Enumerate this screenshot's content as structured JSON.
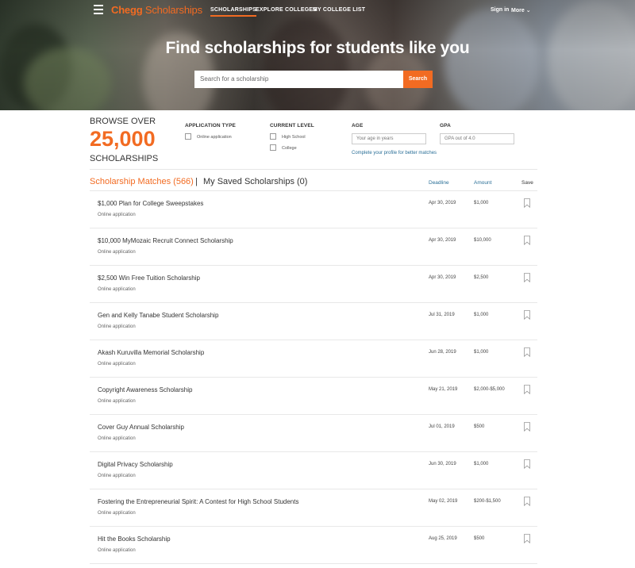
{
  "header": {
    "brand_bold": "Chegg",
    "brand_light": " Scholarships",
    "nav": [
      "SCHOLARSHIPS",
      "EXPLORE COLLEGES",
      "MY COLLEGE LIST"
    ],
    "signin": "Sign in",
    "more": "More",
    "accent": "#f26b22"
  },
  "hero": {
    "title": "Find scholarships for students like you",
    "search_placeholder": "Search for a scholarship",
    "search_button": "Search"
  },
  "browse": {
    "over": "BROWSE OVER",
    "count": "25,000",
    "label": "SCHOLARSHIPS"
  },
  "filters": {
    "application_type": {
      "label": "APPLICATION TYPE",
      "options": [
        "Online application"
      ]
    },
    "current_level": {
      "label": "CURRENT LEVEL",
      "options": [
        "High School",
        "College"
      ]
    },
    "age": {
      "label": "AGE",
      "placeholder": "Your age in years"
    },
    "gpa": {
      "label": "GPA",
      "placeholder": "GPA out of 4.0"
    },
    "profile_link": "Complete your profile for better matches"
  },
  "list": {
    "matches_label": "Scholarship Matches (566)",
    "separator": "|",
    "saved_label": "My Saved Scholarships (0)",
    "col_deadline": "Deadline",
    "col_amount": "Amount",
    "col_save": "Save",
    "rows": [
      {
        "name": "$1,000 Plan for College Sweepstakes",
        "type": "Online application",
        "deadline": "Apr 30, 2019",
        "amount": "$1,000"
      },
      {
        "name": "$10,000 MyMozaic Recruit Connect Scholarship",
        "type": "Online application",
        "deadline": "Apr 30, 2019",
        "amount": "$10,000"
      },
      {
        "name": "$2,500 Win Free Tuition Scholarship",
        "type": "Online application",
        "deadline": "Apr 30, 2019",
        "amount": "$2,500"
      },
      {
        "name": "Gen and Kelly Tanabe Student Scholarship",
        "type": "Online application",
        "deadline": "Jul 31, 2019",
        "amount": "$1,000"
      },
      {
        "name": "Akash Kuruvilla Memorial Scholarship",
        "type": "Online application",
        "deadline": "Jun 28, 2019",
        "amount": "$1,000"
      },
      {
        "name": "Copyright Awareness Scholarship",
        "type": "Online application",
        "deadline": "May 21, 2019",
        "amount": "$2,000-$5,000"
      },
      {
        "name": "Cover Guy Annual Scholarship",
        "type": "Online application",
        "deadline": "Jul 01, 2019",
        "amount": "$500"
      },
      {
        "name": "Digital Privacy Scholarship",
        "type": "Online application",
        "deadline": "Jun 30, 2019",
        "amount": "$1,000"
      },
      {
        "name": "Fostering the Entrepreneurial Spirit: A Contest for High School Students",
        "type": "Online application",
        "deadline": "May 02, 2019",
        "amount": "$200-$1,500"
      },
      {
        "name": "Hit the Books Scholarship",
        "type": "Online application",
        "deadline": "Aug 25, 2019",
        "amount": "$500"
      }
    ]
  }
}
